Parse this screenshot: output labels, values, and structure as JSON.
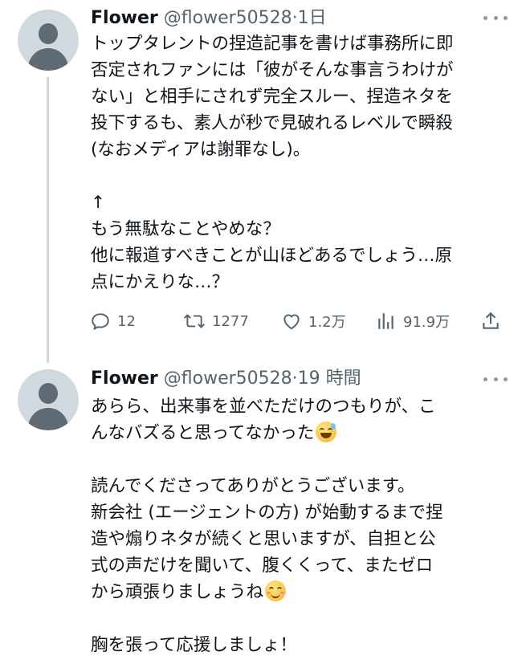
{
  "tweets": [
    {
      "author_name": "Flower",
      "handle": "@flower50528",
      "separator": "·",
      "time": "1日",
      "lines": [
        "トップタレントの捏造記事を書けば事務所に即",
        "否定されファンには「彼がそんな事言うわけが",
        "ない」と相手にされず完全スルー、捏造ネタを",
        "投下するも、素人が秒で見破れるレベルで瞬殺",
        "(なおメディアは謝罪なし)。",
        "",
        "↑",
        "もう無駄なことやめな？",
        "他に報道すべきことが山ほどあるでしょう…原",
        "点にかえりな…？"
      ],
      "stats": {
        "replies": "12",
        "retweets": "1277",
        "likes": "1.2万",
        "views": "91.9万"
      }
    },
    {
      "author_name": "Flower",
      "handle": "@flower50528",
      "separator": "·",
      "time": "19 時間",
      "lines": [
        "あらら、出来事を並べただけのつもりが、こ",
        "んなバズると思ってなかった",
        "",
        "読んでくださってありがとうございます。",
        "新会社 (エージェントの方) が始動するまで捏",
        "造や煽りネタが続くと思いますが、自担と公",
        "式の声だけを聞いて、腹くくって、またゼロ",
        "から頑張りましょうね",
        "",
        "胸を張って応援しましょ！"
      ]
    }
  ],
  "icons": {
    "reply": "speech-bubble-icon",
    "retweet": "retweet-arrows-icon",
    "like": "heart-icon",
    "views": "bar-chart-icon",
    "share": "share-upload-icon",
    "more": "ellipsis-icon",
    "emoji_1": "grinning-sweat-emoji",
    "emoji_2": "smiling-blush-emoji"
  },
  "colors": {
    "text": "#0f1419",
    "secondary": "#536471",
    "avatar_bg": "#cfd9de",
    "thread_line": "#cfd9de"
  }
}
